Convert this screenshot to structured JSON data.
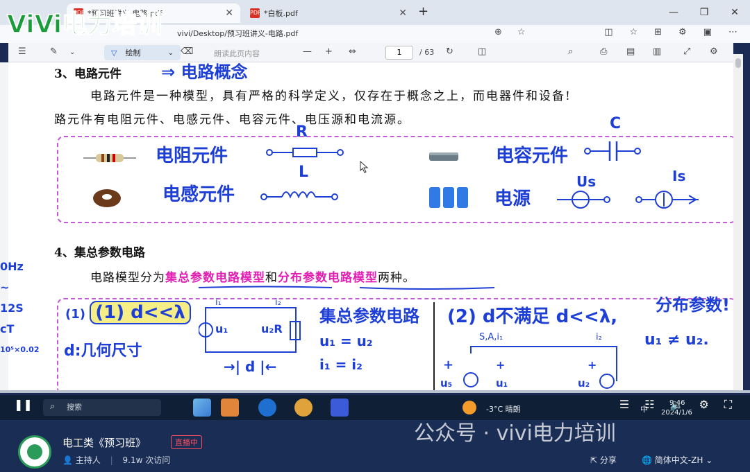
{
  "browser": {
    "tabs": [
      {
        "label": "*预习班讲义-电路.pdf",
        "active": true
      },
      {
        "label": "*白板.pdf",
        "active": false
      }
    ],
    "address": "vivi/Desktop/预习班讲义-电路.pdf"
  },
  "pdf_toolbar": {
    "draw_label": "绘制",
    "read_aloud_label": "朗读此页内容",
    "page_current": "1",
    "page_total": "/ 63"
  },
  "logo_text": "ViVi电力培训",
  "document": {
    "section3_title": "3、电路元件",
    "section3_hw": "⇒ 电路概念",
    "para1": "电路元件是一种模型，具有严格的科学定义，仅存在于概念之上，而电器件和设备!",
    "para2": "路元件有电阻元件、电感元件、电容元件、电压源和电流源。",
    "hw_resistor": "电阻元件",
    "hw_R": "R",
    "hw_capacitor": "电容元件",
    "hw_C": "C",
    "hw_inductor": "电感元件",
    "hw_L": "L",
    "hw_source": "电源",
    "hw_Us": "Us",
    "hw_Is": "Is",
    "section4_title": "4、集总参数电路",
    "para3_pre": "电路模型分为",
    "para3_hl1": "集总参数电路模型",
    "para3_mid": "和",
    "para3_hl2": "分布参数电路模型",
    "para3_post": "两种。",
    "hw_cond1": "(1) d<<λ",
    "hw_geom": "d:几何尺寸",
    "hw_lumped": "集总参数电路",
    "hw_eq1": "u₁ = u₂",
    "hw_eq2": "i₁ = i₂",
    "hw_cond2": "(2) d不满足 d<<λ,",
    "hw_distributed": "分布参数!",
    "hw_neq": "u₁ ≠ u₂."
  },
  "left_notes": [
    "0Hz",
    "~",
    "12S",
    "cT",
    "10⁵×0.02"
  ],
  "taskbar": {
    "search_placeholder": "搜索",
    "weather": "-3°C  晴朗",
    "lang": "中",
    "time": "9:46",
    "date": "2024/1/6"
  },
  "livebar": {
    "title": "电工类《预习班》",
    "live_badge": "直播中",
    "host_label": "主持人",
    "visits": "9.1w 次访问",
    "watermark": "公众号 · vivi电力培训",
    "share_label": "分享",
    "language": "简体中文-ZH"
  }
}
